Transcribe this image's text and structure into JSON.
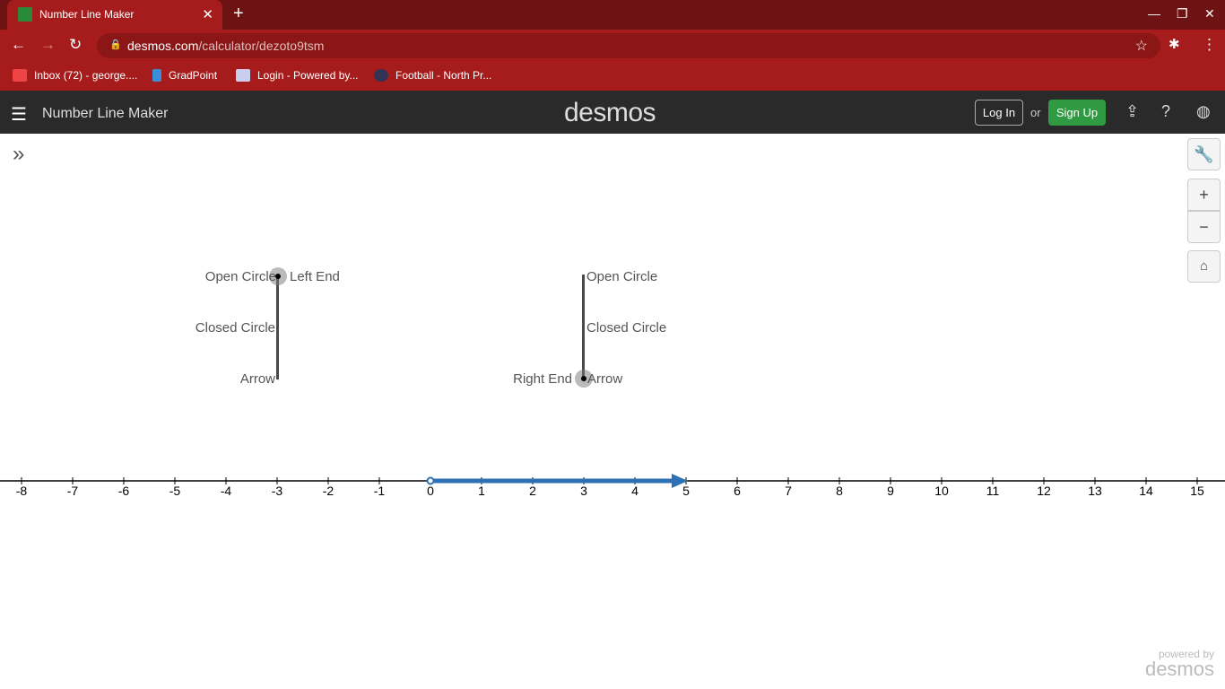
{
  "browser": {
    "tab_title": "Number Line Maker",
    "url_host": "desmos.com",
    "url_path": "/calculator/dezoto9tsm",
    "bookmarks": [
      "Inbox (72) - george....",
      "GradPoint",
      "Login - Powered by...",
      "Football - North Pr..."
    ]
  },
  "header": {
    "title": "Number Line Maker",
    "logo": "desmos",
    "login": "Log In",
    "or": "or",
    "signup": "Sign Up"
  },
  "graph": {
    "left_labels": {
      "open": "Open Circle",
      "closed": "Closed Circle",
      "arrow": "Arrow",
      "end": "Left End"
    },
    "right_labels": {
      "open": "Open Circle",
      "closed": "Closed Circle",
      "arrow": "Arrow",
      "end": "Right End"
    },
    "axis": {
      "min": -8,
      "max": 15,
      "ticks": [
        -8,
        -7,
        -6,
        -5,
        -4,
        -3,
        -2,
        -1,
        0,
        1,
        2,
        3,
        4,
        5,
        6,
        7,
        8,
        9,
        10,
        11,
        12,
        13,
        14,
        15
      ]
    },
    "interval": {
      "start": 0,
      "end": 5,
      "start_type": "open",
      "end_type": "arrow",
      "color": "#2d70b3"
    },
    "left_selector_value": -3,
    "right_selector_value": 3
  },
  "footer": {
    "powered": "powered by",
    "brand": "desmos"
  }
}
